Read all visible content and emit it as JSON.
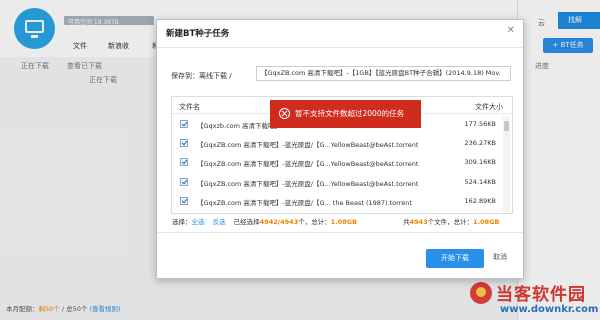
{
  "app": {
    "space_label": "可用空间 19.36TB",
    "menu": [
      "文件",
      "新浪收",
      "和"
    ],
    "subnav": [
      "正在下载",
      "查看已下载",
      "正在下载"
    ],
    "right_panel": {
      "settings_label": "云",
      "find_label": "找解",
      "bt_button_label": "+ BT任务",
      "progress_label": "进度"
    },
    "quota": {
      "prefix": "本月配额：",
      "remaining": "剩50个",
      "separator": " / 总50个 ",
      "link": "(查看规则)"
    }
  },
  "modal": {
    "title": "新建BT种子任务",
    "close_icon": "close-icon",
    "save_to_label": "保存到：离线下载 /",
    "save_to_value": "【GqxZB.com 高清下载吧】-【1GB】【蓝光原盘BT种子合辑】(2014.9.18) Mov.",
    "columns": {
      "name": "文件名",
      "size": "文件大小"
    },
    "rows": [
      {
        "name": "【Gqxzb.com 高清下载吧】",
        "size": "177.56KB",
        "checked": true
      },
      {
        "name": "【GqxZB.com 高清下载吧】-蓝光原盘/【G...YellowBeast@beAst.torrent",
        "size": "236.27KB",
        "checked": true
      },
      {
        "name": "【GqxZB.com 高清下载吧】-蓝光原盘/【G...YellowBeast@beAst.torrent",
        "size": "309.16KB",
        "checked": true
      },
      {
        "name": "【GqxZB.com 高清下载吧】-蓝光原盘/【G...YellowBeast@beAst.torrent",
        "size": "524.14KB",
        "checked": true
      },
      {
        "name": "【GqxZB.com 高清下载吧】-蓝光原盘/【G... the Beast (1987).torrent",
        "size": "162.89KB",
        "checked": true
      }
    ],
    "summary": {
      "select_label": "选择：",
      "select_all": "全选",
      "invert": "反选",
      "selected_prefix": "已经选择",
      "selected_count": "4942/4943",
      "selected_unit": "个，总计：",
      "selected_size": "1.08GB"
    },
    "summary_right": {
      "total_prefix": "共",
      "total_count": "4943",
      "total_unit": "个文件，总计：",
      "total_size": "1.08GB"
    },
    "start_button": "开始下载",
    "cancel_button": "取消"
  },
  "toast": {
    "message": "暂不支持文件数超过2000的任务",
    "icon": "error-circle-icon",
    "color": "#cf2c1e"
  },
  "watermark": {
    "title": "当客软件园",
    "url": "www.downkr.com"
  }
}
